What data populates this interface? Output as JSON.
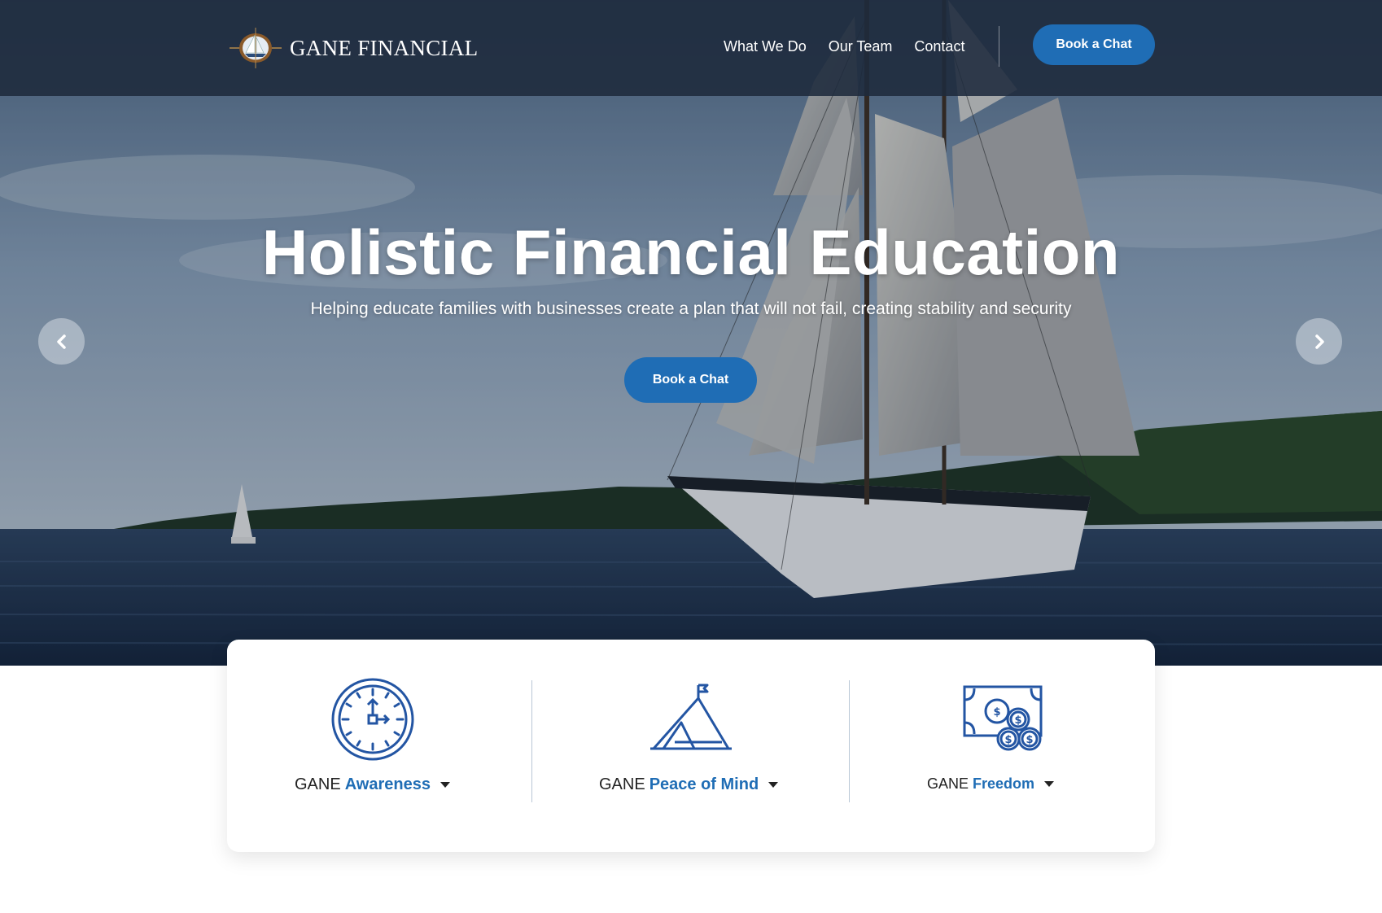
{
  "header": {
    "brand": "GANE FINANCIAL",
    "nav": [
      {
        "label": "What We Do"
      },
      {
        "label": "Our Team"
      },
      {
        "label": "Contact"
      }
    ],
    "cta_label": "Book a Chat"
  },
  "hero": {
    "title": "Holistic Financial Education",
    "subtitle": "Helping educate families with businesses create a plan that will not fail, creating stability and security",
    "cta_label": "Book a Chat"
  },
  "features": [
    {
      "prefix": "GANE",
      "accent": "Awareness",
      "icon": "clock-icon"
    },
    {
      "prefix": "GANE",
      "accent": "Peace of Mind",
      "icon": "mountain-flag-icon"
    },
    {
      "prefix": "GANE",
      "accent": "Freedom",
      "icon": "money-coins-icon"
    }
  ],
  "colors": {
    "header_bg": "#1e2a3c",
    "accent_blue": "#1f6db5",
    "icon_blue": "#2355a3",
    "card_bg": "#ffffff"
  }
}
